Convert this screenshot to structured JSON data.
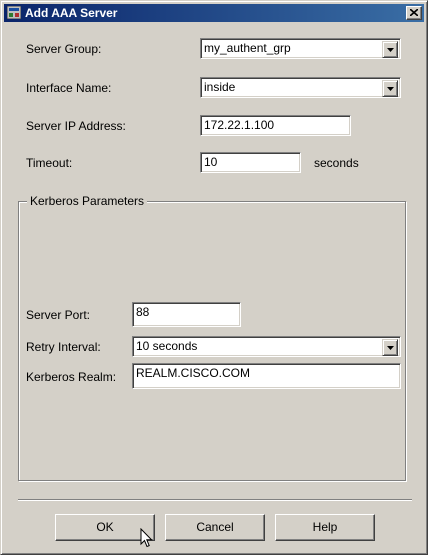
{
  "window": {
    "title": "Add AAA Server",
    "icon": "window-app-icon",
    "close_icon": "close-icon"
  },
  "fields": {
    "server_group": {
      "label": "Server Group:",
      "value": "my_authent_grp"
    },
    "interface_name": {
      "label": "Interface Name:",
      "value": "inside"
    },
    "server_ip": {
      "label": "Server IP Address:",
      "value": "172.22.1.100"
    },
    "timeout": {
      "label": "Timeout:",
      "value": "10",
      "unit": "seconds"
    }
  },
  "kerberos": {
    "group_title": "Kerberos Parameters",
    "server_port": {
      "label": "Server Port:",
      "value": "88"
    },
    "retry_interval": {
      "label": "Retry Interval:",
      "value": "10 seconds"
    },
    "realm": {
      "label": "Kerberos Realm:",
      "value": "REALM.CISCO.COM"
    }
  },
  "buttons": {
    "ok": "OK",
    "cancel": "Cancel",
    "help": "Help"
  },
  "colors": {
    "face": "#d4d0c8",
    "title_start": "#0a246a",
    "title_end": "#3a6ea5"
  }
}
